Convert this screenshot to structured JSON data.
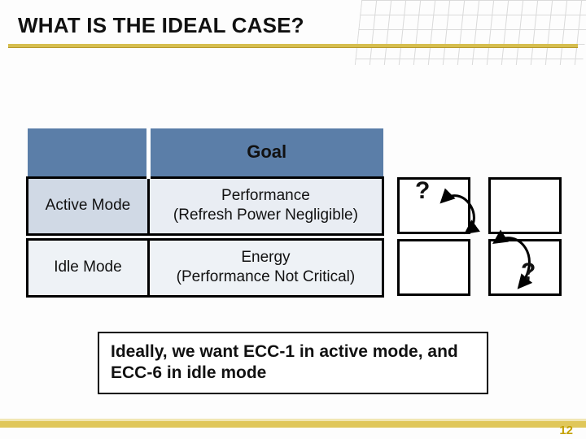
{
  "title": "WHAT IS THE IDEAL CASE?",
  "table": {
    "header_goal": "Goal",
    "rows": [
      {
        "label": "Active Mode",
        "value_line1": "Performance",
        "value_line2": "(Refresh Power Negligible)"
      },
      {
        "label": "Idle Mode",
        "value_line1": "Energy",
        "value_line2": "(Performance Not Critical)"
      }
    ]
  },
  "question_mark_1": "?",
  "question_mark_2": "?",
  "callout": "Ideally, we want ECC-1 in active mode, and ECC-6 in idle mode",
  "page_number": "12"
}
